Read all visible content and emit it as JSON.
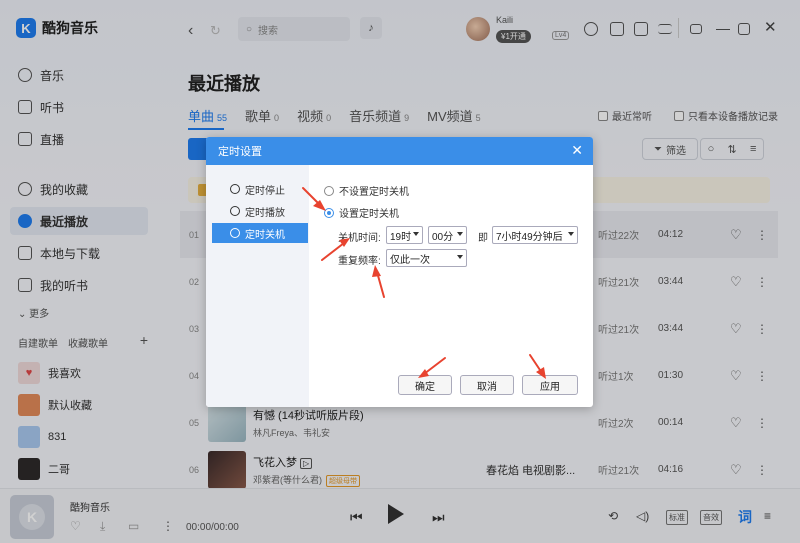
{
  "app": {
    "name": "酷狗音乐",
    "logo_letter": "K"
  },
  "sidebar": {
    "items": [
      {
        "label": "音乐",
        "icon": "home-icon"
      },
      {
        "label": "听书",
        "icon": "book-icon"
      },
      {
        "label": "直播",
        "icon": "live-icon"
      },
      {
        "label": "我的收藏",
        "icon": "heart-icon"
      },
      {
        "label": "最近播放",
        "icon": "clock-icon"
      },
      {
        "label": "本地与下载",
        "icon": "download-icon"
      },
      {
        "label": "我的听书",
        "icon": "book-icon"
      }
    ],
    "more": "更多",
    "tabs": [
      "自建歌单",
      "收藏歌单"
    ],
    "add": "+",
    "playlists": [
      {
        "name": "我喜欢",
        "color": "#f0dada"
      },
      {
        "name": "默认收藏",
        "color": "#e28a5a"
      },
      {
        "name": "831",
        "color": "#a9c8ef"
      },
      {
        "name": "二哥",
        "color": "#2e2a2a"
      }
    ]
  },
  "topbar": {
    "search_placeholder": "搜索",
    "username": "Kaili",
    "vip": "¥1开通",
    "level": "Lv4"
  },
  "main": {
    "title": "最近播放",
    "tabs": [
      {
        "label": "单曲",
        "count": "55"
      },
      {
        "label": "歌单",
        "count": "0"
      },
      {
        "label": "视频",
        "count": "0"
      },
      {
        "label": "音乐频道",
        "count": "9"
      },
      {
        "label": "MV频道",
        "count": "5"
      }
    ],
    "check_recent": "最近常听",
    "check_device": "只看本设备播放记录",
    "filter": "筛选",
    "rows": [
      {
        "num": "01",
        "title": "",
        "artist": "",
        "album": "",
        "heard": "听过22次",
        "duration": "04:12"
      },
      {
        "num": "02",
        "title": "",
        "artist": "",
        "album": "",
        "heard": "听过21次",
        "duration": "03:44"
      },
      {
        "num": "03",
        "title": "",
        "artist": "",
        "album": "",
        "heard": "听过21次",
        "duration": "03:44"
      },
      {
        "num": "04",
        "title": "",
        "artist": "",
        "album": "",
        "heard": "听过1次",
        "duration": "01:30"
      },
      {
        "num": "05",
        "title": "有憾 (14秒试听版片段)",
        "artist": "林凡Freya、韦礼安",
        "album": "",
        "heard": "听过2次",
        "duration": "00:14"
      },
      {
        "num": "06",
        "title": "飞花入梦",
        "artist": "邓紫君(等什么君)",
        "badge": "超级母带",
        "album": "春花焰 电视剧影...",
        "heard": "听过21次",
        "duration": "04:16"
      }
    ]
  },
  "player": {
    "title": "酷狗音乐",
    "time": "00:00/00:00",
    "quality": "标准",
    "effect": "音效",
    "lyrics": "词"
  },
  "dialog": {
    "title": "定时设置",
    "side": [
      "定时停止",
      "定时播放",
      "定时关机"
    ],
    "option_none": "不设置定时关机",
    "option_set": "设置定时关机",
    "time_label": "关机时间:",
    "hour": "19时",
    "minute": "00分",
    "ji": "即",
    "countdown": "7小时49分钟后",
    "repeat_label": "重复频率:",
    "repeat": "仅此一次",
    "ok": "确定",
    "cancel": "取消",
    "apply": "应用"
  },
  "colors": {
    "accent": "#1f7df0",
    "dialog_header": "#3a8ee8",
    "annotation_arrow": "#e8432f"
  }
}
